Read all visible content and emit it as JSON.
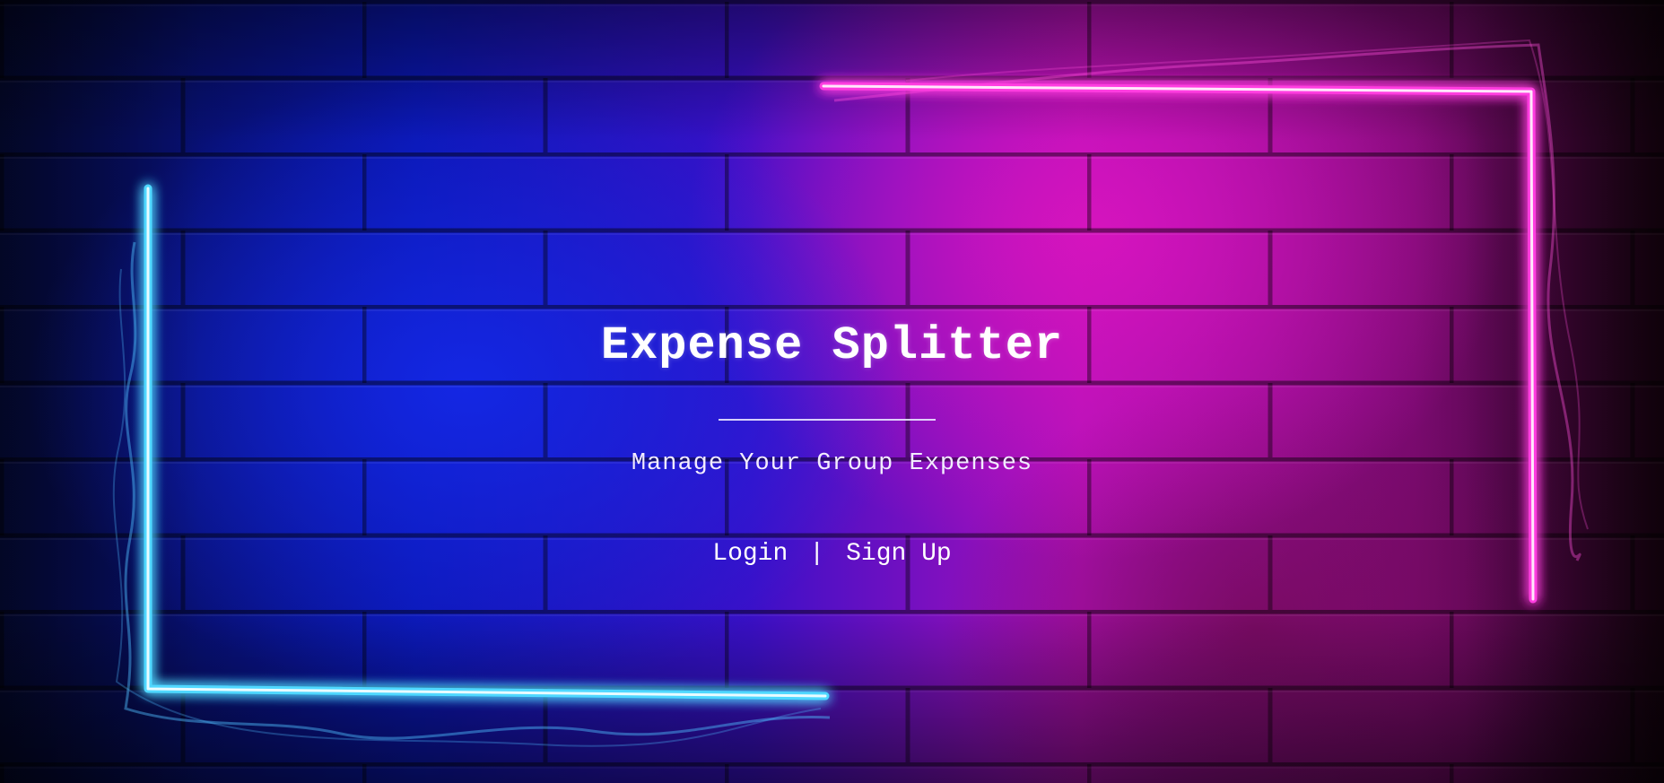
{
  "app": {
    "title": "Expense Splitter",
    "subtitle": "Manage Your Group Expenses"
  },
  "nav": {
    "login_label": "Login",
    "separator": "|",
    "signup_label": "Sign Up"
  },
  "theme": {
    "neon_blue": "#4fd8ff",
    "neon_pink": "#ff3ce0",
    "text": "#ffffff"
  }
}
